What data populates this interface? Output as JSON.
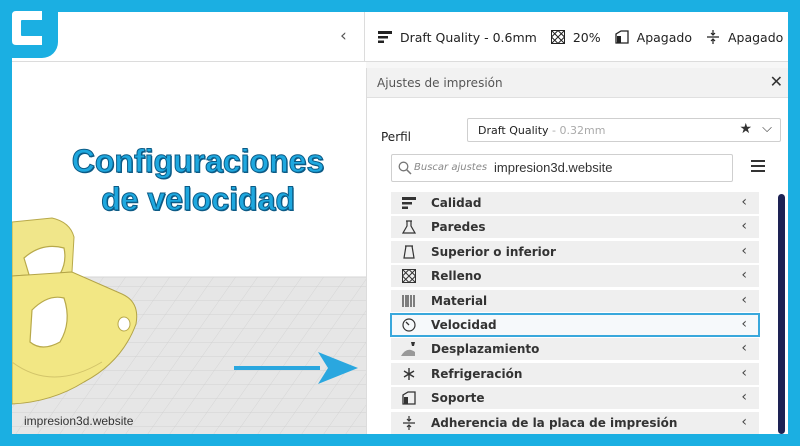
{
  "topbar": {
    "quality": "Draft Quality - 0.6mm",
    "infill": "20%",
    "support": "Apagado",
    "adhesion": "Apagado",
    "collapse_icon": "chevron-left-icon"
  },
  "viewport": {
    "headline_line1": "Configuraciones",
    "headline_line2": "de velocidad",
    "watermark": "impresion3d.website",
    "model_color": "#f0e68a",
    "arrow_color": "#2aa7df"
  },
  "panel": {
    "title": "Ajustes de impresión",
    "close": "✕",
    "profile_label": "Perfil",
    "profile_value": "Draft Quality",
    "profile_detail": "- 0.32mm",
    "search_placeholder": "Buscar ajustes",
    "search_overlay": "impresion3d.website",
    "categories": [
      {
        "label": "Calidad",
        "icon": "quality-icon"
      },
      {
        "label": "Paredes",
        "icon": "walls-icon"
      },
      {
        "label": "Superior o inferior",
        "icon": "top-bottom-icon"
      },
      {
        "label": "Relleno",
        "icon": "infill-icon"
      },
      {
        "label": "Material",
        "icon": "material-icon"
      },
      {
        "label": "Velocidad",
        "icon": "speed-icon",
        "active": true
      },
      {
        "label": "Desplazamiento",
        "icon": "travel-icon"
      },
      {
        "label": "Refrigeración",
        "icon": "cooling-icon"
      },
      {
        "label": "Soporte",
        "icon": "support-icon"
      },
      {
        "label": "Adherencia de la placa de impresión",
        "icon": "adhesion-icon"
      }
    ]
  },
  "colors": {
    "accent": "#1bafe2",
    "active_outline": "#39a8dc",
    "scrollbar": "#1d2254"
  }
}
